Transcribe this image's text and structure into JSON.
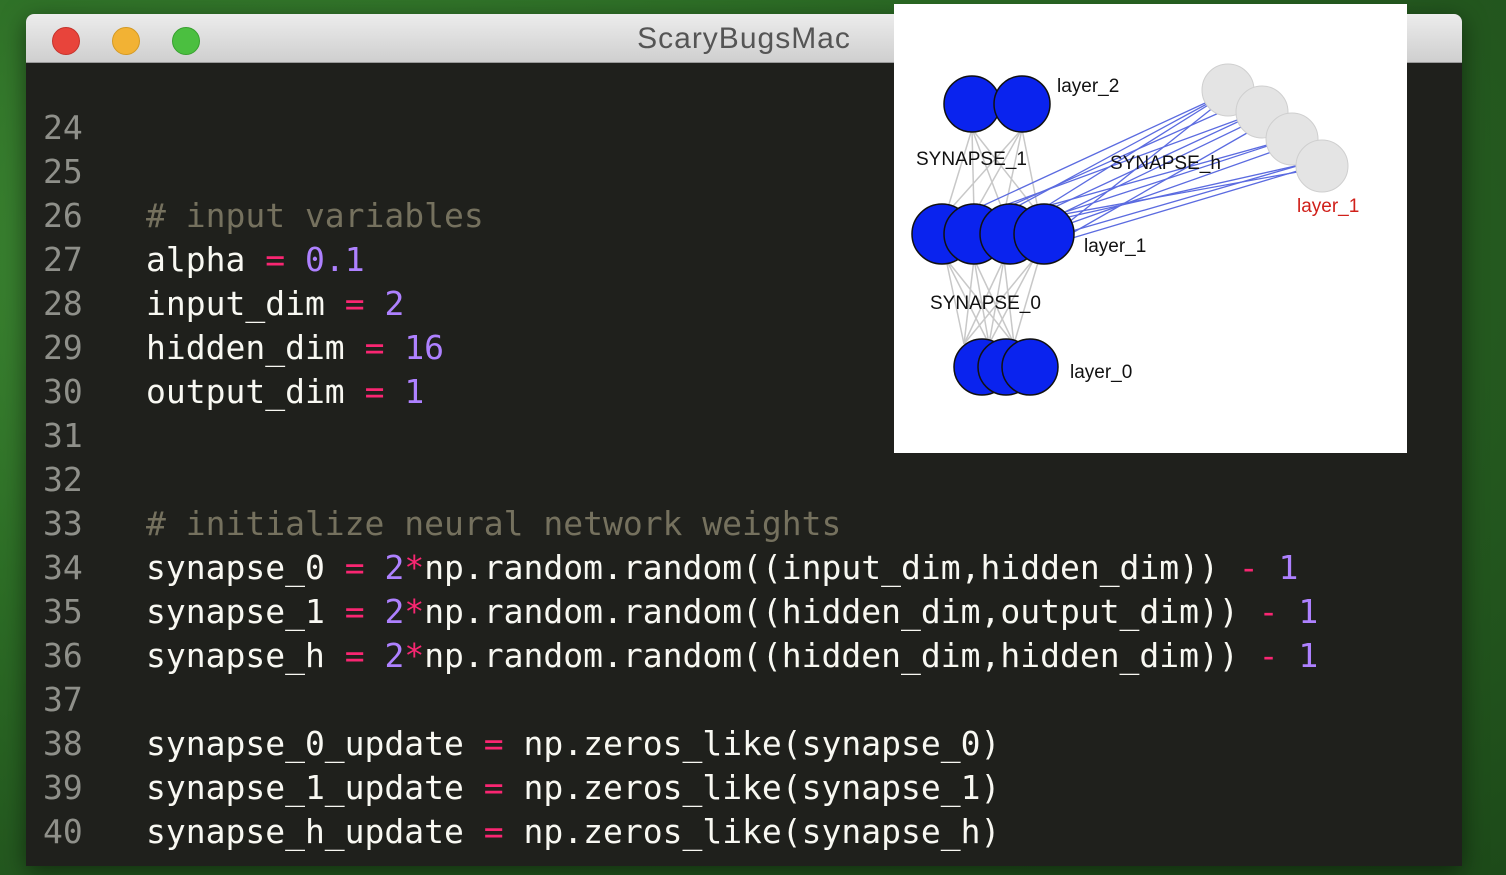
{
  "window": {
    "title": "ScaryBugsMac"
  },
  "editor": {
    "line_numbers": [
      "24",
      "25",
      "26",
      "27",
      "28",
      "29",
      "30",
      "31",
      "32",
      "33",
      "34",
      "35",
      "36",
      "37",
      "38",
      "39",
      "40"
    ],
    "code": {
      "l25_comment": "# input variables",
      "l26_var": "alpha",
      "l26_op": "=",
      "l26_num": "0.1",
      "l27_var": "input_dim",
      "l27_op": "=",
      "l27_num": "2",
      "l28_var": "hidden_dim",
      "l28_op": "=",
      "l28_num": "16",
      "l29_var": "output_dim",
      "l29_op": "=",
      "l29_num": "1",
      "l32_comment": "# initialize neural network weights",
      "l33_var": "synapse_0",
      "l33_op": "=",
      "l33_num": "2",
      "l33_star": "*",
      "l33_call": "np.random.random((input_dim,hidden_dim))",
      "l33_minus": "-",
      "l33_one": "1",
      "l34_var": "synapse_1",
      "l34_op": "=",
      "l34_num": "2",
      "l34_star": "*",
      "l34_call": "np.random.random((hidden_dim,output_dim))",
      "l34_minus": "-",
      "l34_one": "1",
      "l35_var": "synapse_h",
      "l35_op": "=",
      "l35_num": "2",
      "l35_star": "*",
      "l35_call": "np.random.random((hidden_dim,hidden_dim))",
      "l35_minus": "-",
      "l35_one": "1",
      "l37_var": "synapse_0_update",
      "l37_op": "=",
      "l37_call": "np.zeros_like(synapse_0)",
      "l38_var": "synapse_1_update",
      "l38_op": "=",
      "l38_call": "np.zeros_like(synapse_1)",
      "l39_var": "synapse_h_update",
      "l39_op": "=",
      "l39_call": "np.zeros_like(synapse_h)"
    },
    "colors": {
      "background": "#1f201c",
      "comment": "#75715e",
      "operator": "#f92672",
      "number": "#ae81ff",
      "text": "#f8f8f2"
    }
  },
  "diagram": {
    "labels": {
      "layer_2": "layer_2",
      "synapse_1": "SYNAPSE_1",
      "synapse_h": "SYNAPSE_h",
      "layer_1_prev": "layer_1",
      "layer_1": "layer_1",
      "synapse_0": "SYNAPSE_0",
      "layer_0": "layer_0"
    },
    "colors": {
      "node_active": "#0a23ee",
      "node_prev": "#e4e4e4",
      "recurrent_edge": "#5b6be0",
      "edge": "#c8c8c8",
      "prev_label": "#d0201a"
    }
  }
}
